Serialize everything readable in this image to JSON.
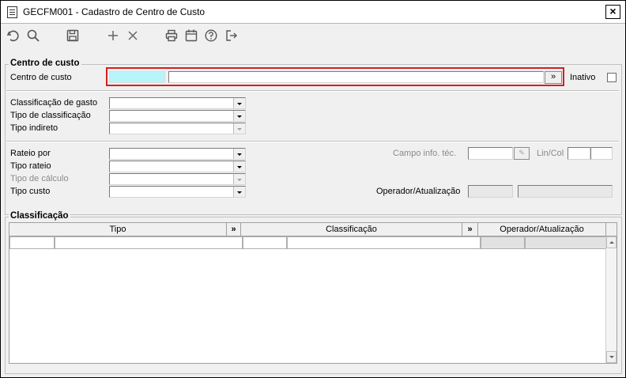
{
  "window": {
    "title": "GECFM001 - Cadastro de Centro de Custo",
    "close": "×"
  },
  "toolbar": {
    "icons": [
      "undo-icon",
      "search-icon",
      "save-icon",
      "add-icon",
      "delete-icon",
      "print-icon",
      "calendar-icon",
      "help-icon",
      "exit-icon"
    ]
  },
  "centro": {
    "legend": "Centro de custo",
    "label": "Centro de custo",
    "code_value": "",
    "desc_value": "",
    "lookup_btn": "»",
    "inativo_label": "Inativo"
  },
  "gasto": {
    "classificacao_label": "Classificação de gasto",
    "tipo_classificacao_label": "Tipo de classificação",
    "tipo_indireto_label": "Tipo indireto"
  },
  "rateio": {
    "rateio_por_label": "Rateio por",
    "tipo_rateio_label": "Tipo rateio",
    "tipo_calculo_label": "Tipo de cálculo",
    "tipo_custo_label": "Tipo custo",
    "campo_info_label": "Campo info. téc.",
    "lincol_label": "Lin/Col",
    "operador_label": "Operador/Atualização"
  },
  "classificacao": {
    "legend": "Classificação",
    "columns": [
      "Tipo",
      "»",
      "Classificação",
      "»",
      "Operador/Atualização"
    ]
  },
  "colors": {
    "highlight": "#d42020",
    "key_field": "#b7f5fb"
  }
}
